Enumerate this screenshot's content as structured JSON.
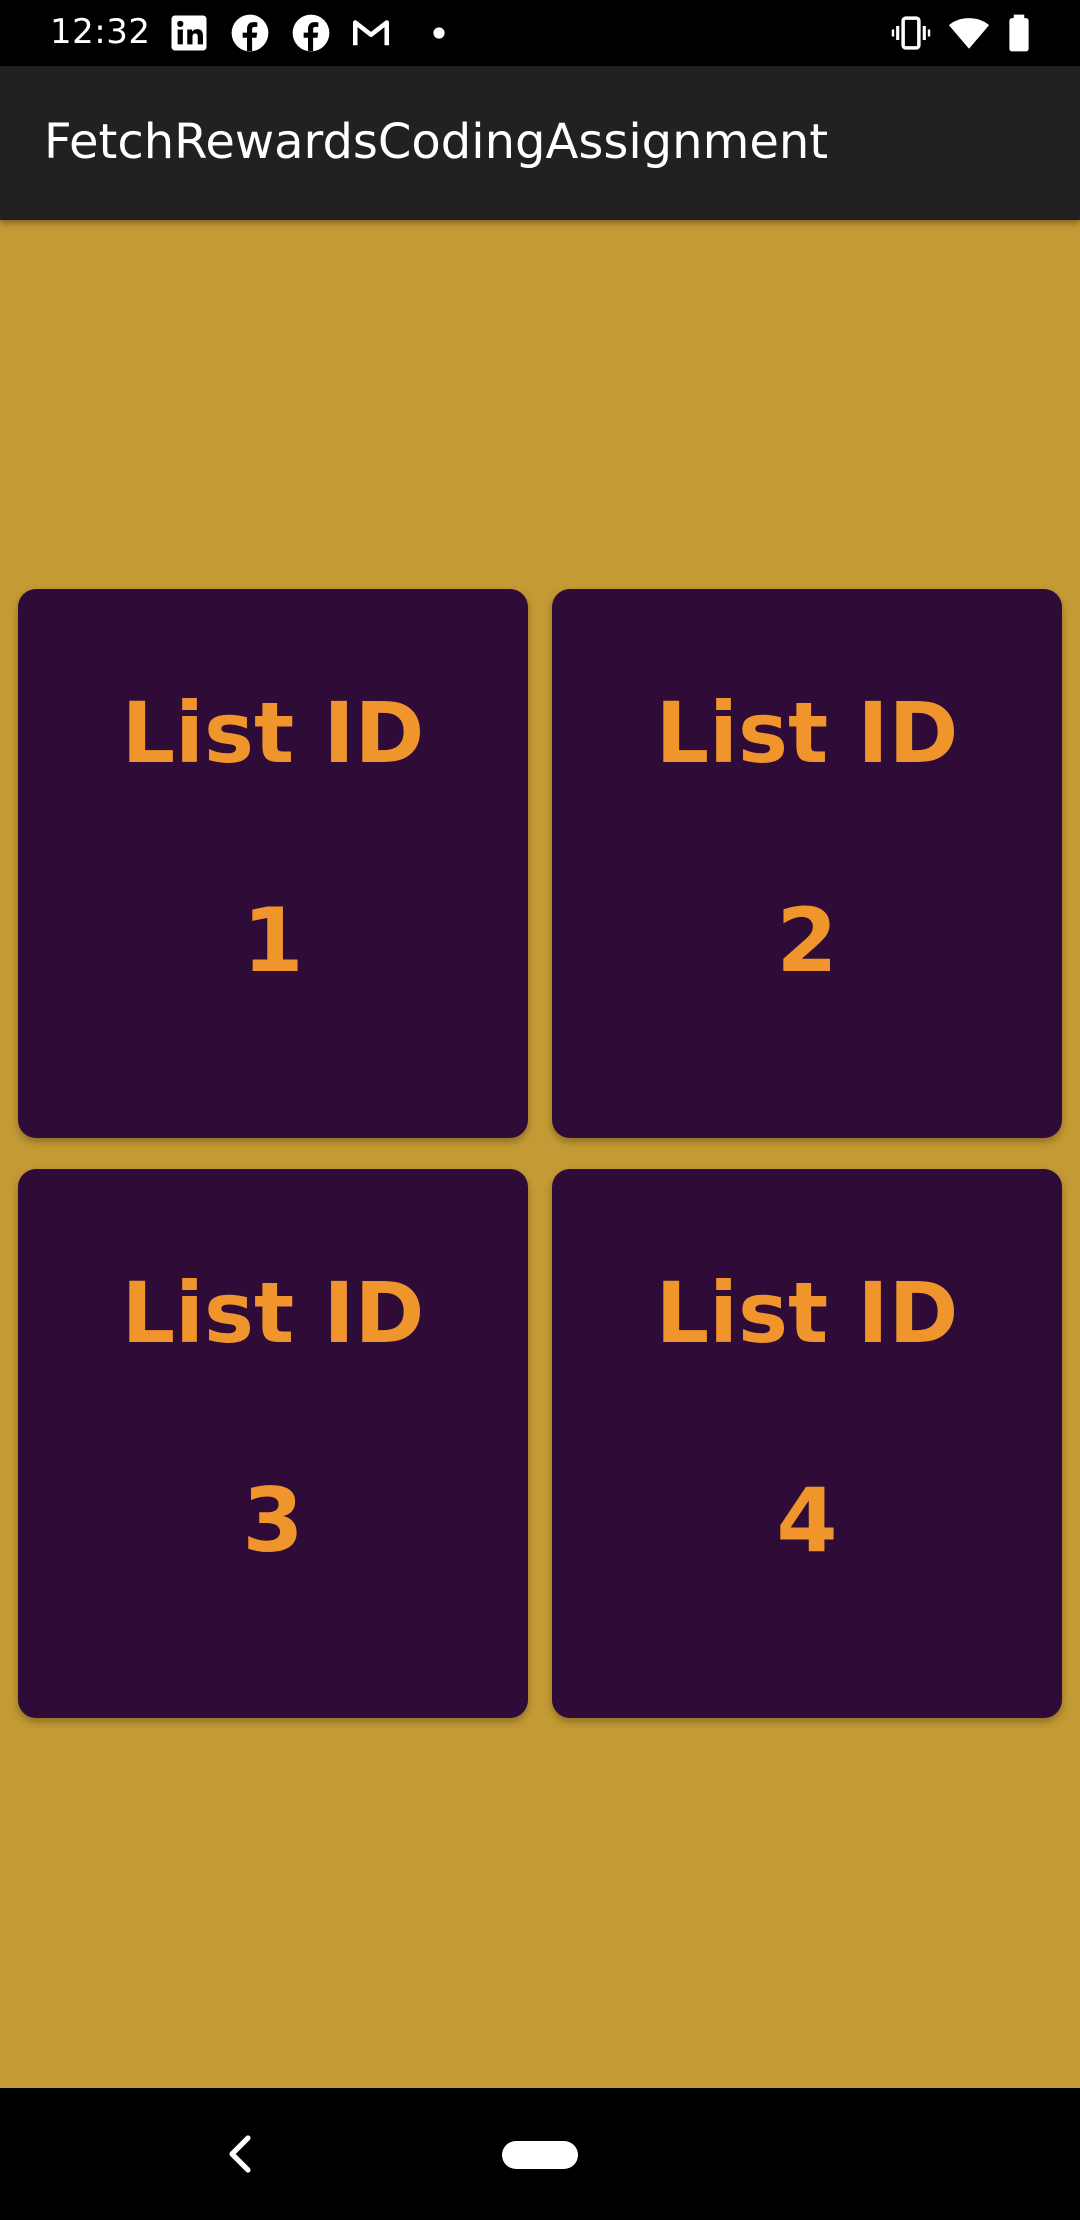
{
  "status_bar": {
    "time": "12:32",
    "icons": [
      "linkedin-icon",
      "facebook-icon",
      "facebook-icon",
      "gmail-icon",
      "notification-dot-icon",
      "vibrate-icon",
      "wifi-icon",
      "battery-icon"
    ]
  },
  "app_bar": {
    "title": "FetchRewardsCodingAssignment"
  },
  "cards": [
    {
      "label": "List ID",
      "value": "1"
    },
    {
      "label": "List ID",
      "value": "2"
    },
    {
      "label": "List ID",
      "value": "3"
    },
    {
      "label": "List ID",
      "value": "4"
    }
  ],
  "nav_bar": {
    "icons": [
      "back-icon",
      "home-pill-icon"
    ]
  },
  "colors": {
    "background": "#c49a34",
    "app_bar": "#212121",
    "card": "#2f0c37",
    "card_text": "#f0952c",
    "status_bar": "#000000"
  }
}
